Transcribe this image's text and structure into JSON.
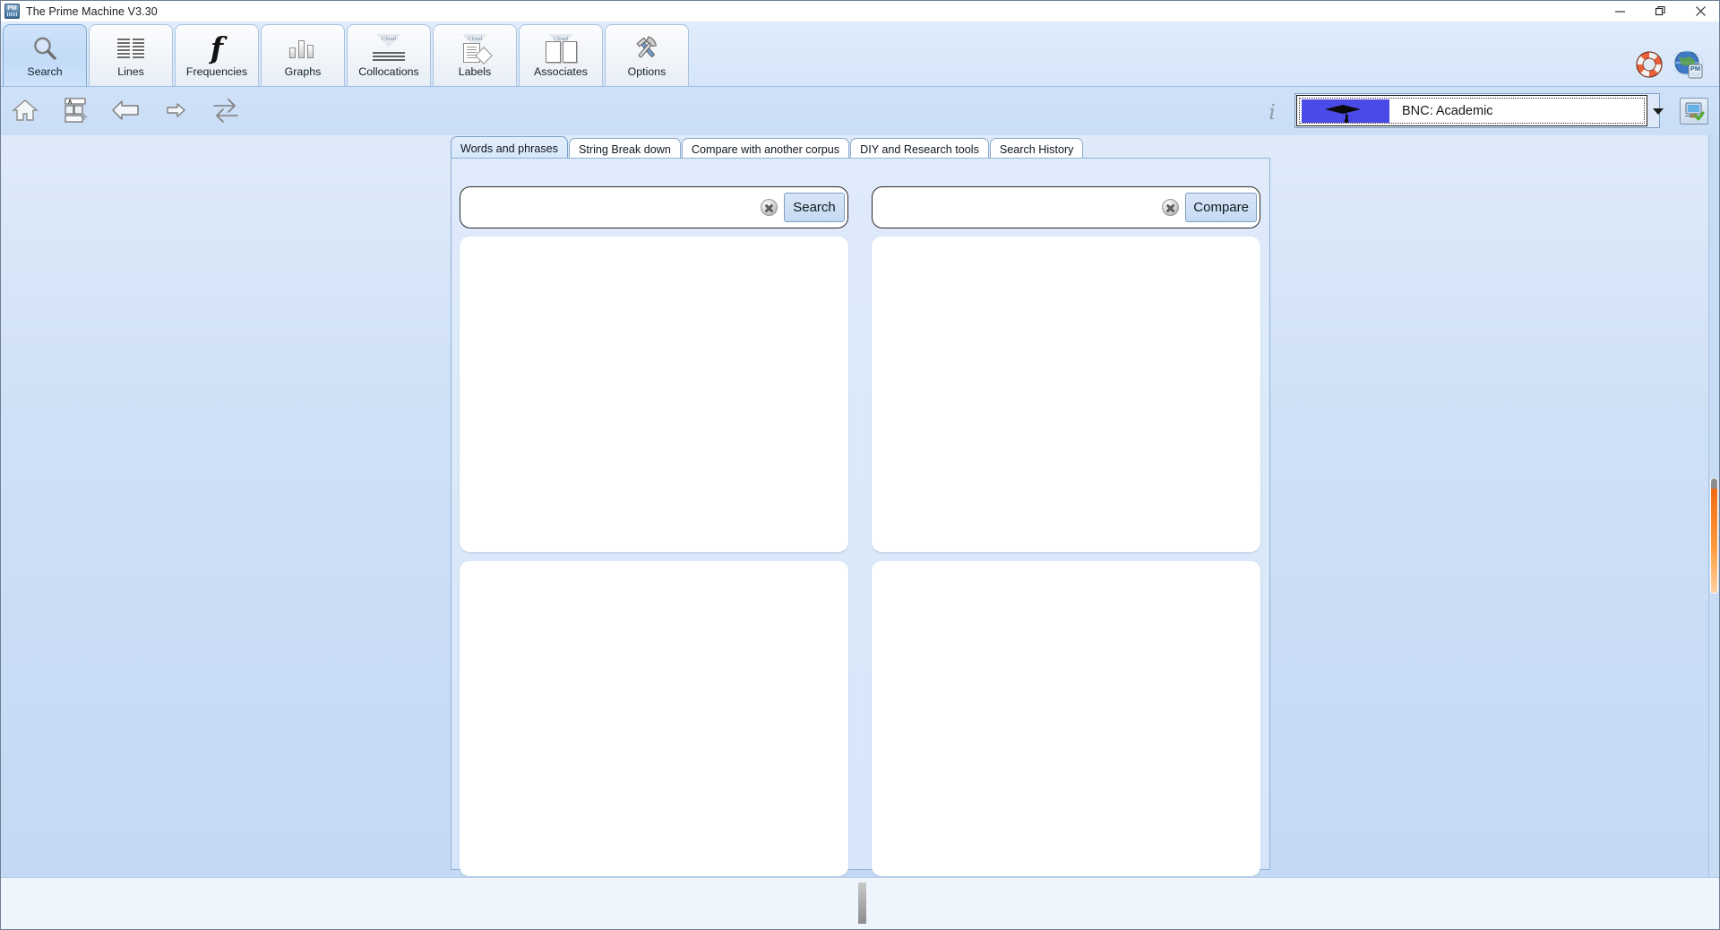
{
  "window": {
    "title": "The Prime Machine V3.30",
    "app_icon": "pm-app-icon",
    "controls": {
      "minimize": "minimize-icon",
      "restore": "restore-icon",
      "close": "close-icon"
    }
  },
  "ribbon": {
    "tabs": [
      {
        "label": "Search",
        "icon": "magnifier-icon",
        "active": true
      },
      {
        "label": "Lines",
        "icon": "concordance-lines-icon",
        "active": false
      },
      {
        "label": "Frequencies",
        "icon": "italic-f-icon",
        "active": false
      },
      {
        "label": "Graphs",
        "icon": "bar-chart-icon",
        "active": false
      },
      {
        "label": "Collocations",
        "icon": "cloud-funnel-lines-icon",
        "active": false
      },
      {
        "label": "Labels",
        "icon": "document-tag-icon",
        "active": false
      },
      {
        "label": "Associates",
        "icon": "open-books-icon",
        "active": false
      },
      {
        "label": "Options",
        "icon": "wrench-hammer-icon",
        "active": false
      }
    ]
  },
  "help_icons": [
    {
      "name": "life-ring-help-icon"
    },
    {
      "name": "globe-pm-icon"
    }
  ],
  "navbar": {
    "items": [
      {
        "name": "home-icon",
        "label": "Home"
      },
      {
        "name": "new-card-icon",
        "label": "New card"
      },
      {
        "name": "back-arrow-icon",
        "label": "Back"
      },
      {
        "name": "forward-arrow-icon",
        "label": "Forward"
      },
      {
        "name": "swap-arrows-icon",
        "label": "Swap"
      }
    ],
    "info_icon": "information-icon"
  },
  "corpus_selector": {
    "label": "BNC: Academic",
    "swatch_icon": "graduation-cap-icon",
    "swatch_color": "#4a4ae8",
    "dropdown_icon": "chevron-down-icon",
    "export_icon": "computer-check-icon"
  },
  "content_tabs": [
    {
      "label": "Words and phrases",
      "active": true
    },
    {
      "label": "String Break down",
      "active": false
    },
    {
      "label": "Compare with another corpus",
      "active": false
    },
    {
      "label": "DIY and Research tools",
      "active": false
    },
    {
      "label": "Search History",
      "active": false
    }
  ],
  "panes": {
    "left": {
      "search": {
        "value": "",
        "placeholder": "",
        "clear_icon": "clear-circle-icon",
        "button_label": "Search"
      },
      "result_top": "",
      "result_bottom": ""
    },
    "right": {
      "search": {
        "value": "",
        "placeholder": "",
        "clear_icon": "clear-circle-icon",
        "button_label": "Compare"
      },
      "result_top": "",
      "result_bottom": ""
    }
  },
  "statusbar": {
    "text": "",
    "grip_name": "status-grip"
  },
  "scrollbar": {
    "name": "vertical-scrollbar",
    "thumb_color": "#f06a12"
  }
}
